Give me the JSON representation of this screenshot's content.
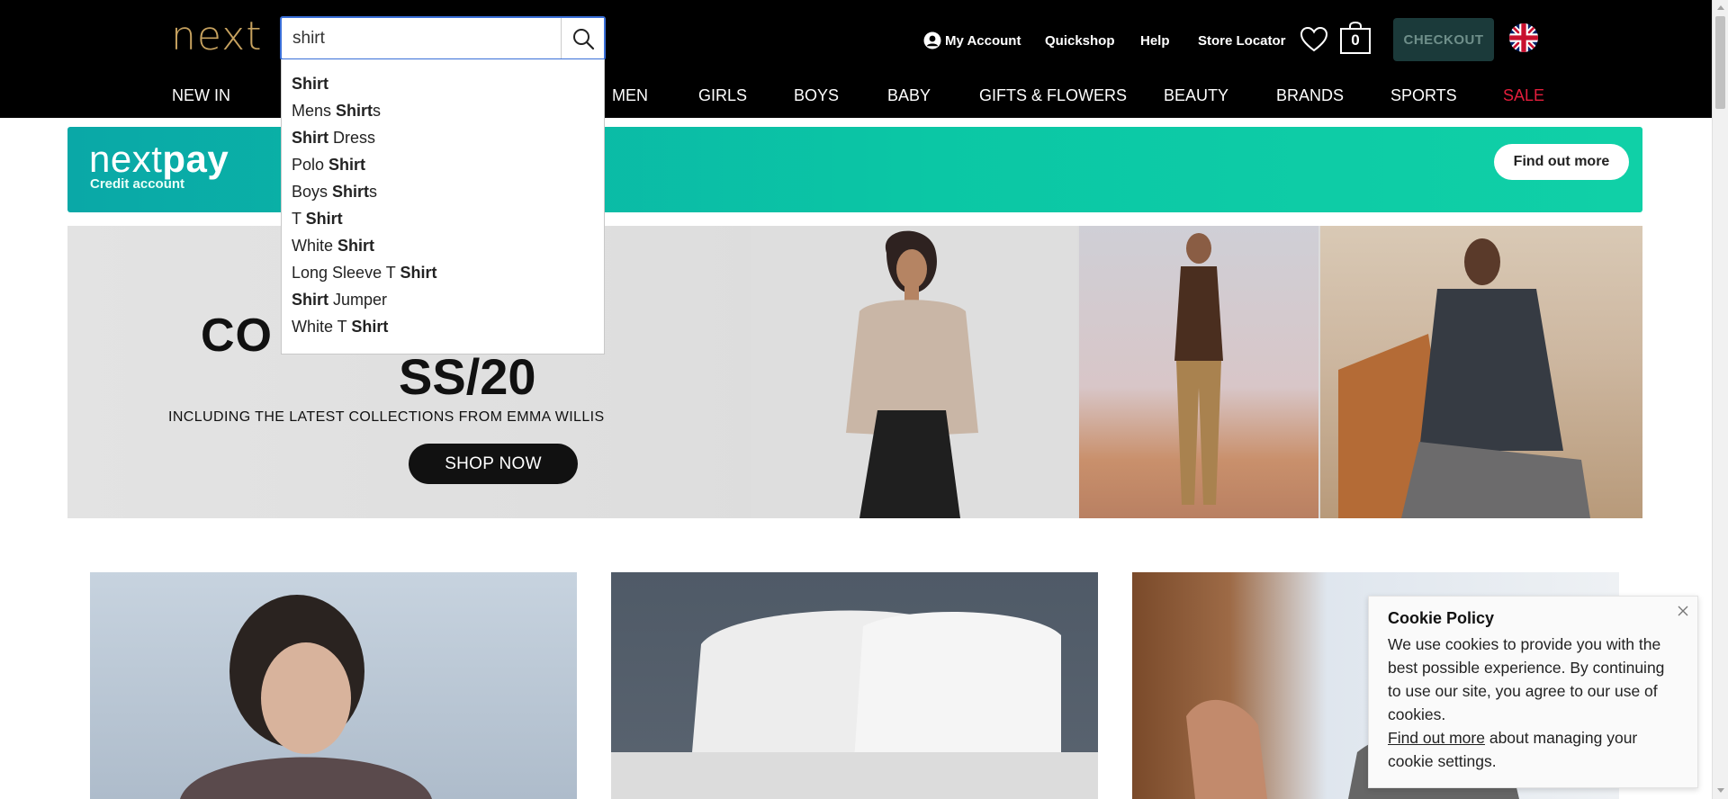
{
  "header": {
    "logo": "next",
    "search": {
      "value": "shirt",
      "button_icon": "search-icon"
    },
    "links": {
      "my_account": "My Account",
      "quickshop": "Quickshop",
      "help": "Help",
      "store_locator": "Store Locator"
    },
    "bag_count": "0",
    "checkout": "CHECKOUT",
    "flag_icon": "uk-flag-icon"
  },
  "nav": {
    "items": [
      "NEW IN",
      "MEN",
      "GIRLS",
      "BOYS",
      "BABY",
      "GIFTS & FLOWERS",
      "BEAUTY",
      "BRANDS",
      "SPORTS",
      "SALE"
    ],
    "sale_color": "#e31e3c"
  },
  "suggestions": [
    {
      "pre": "",
      "bold": "Shirt",
      "post": ""
    },
    {
      "pre": "Mens ",
      "bold": "Shirt",
      "post": "s"
    },
    {
      "pre": "",
      "bold": "Shirt",
      "post": " Dress"
    },
    {
      "pre": "Polo ",
      "bold": "Shirt",
      "post": ""
    },
    {
      "pre": "Boys ",
      "bold": "Shirt",
      "post": "s"
    },
    {
      "pre": "T ",
      "bold": "Shirt",
      "post": ""
    },
    {
      "pre": "White ",
      "bold": "Shirt",
      "post": ""
    },
    {
      "pre": "Long Sleeve T ",
      "bold": "Shirt",
      "post": ""
    },
    {
      "pre": "",
      "bold": "Shirt",
      "post": " Jumper"
    },
    {
      "pre": "White T ",
      "bold": "Shirt",
      "post": ""
    }
  ],
  "nextpay": {
    "logo_next": "next",
    "logo_pay": "pay",
    "subtitle": "Credit account",
    "button": "Find out more",
    "colors": {
      "start": "#0aa8a7",
      "end": "#10d0a7"
    }
  },
  "hero": {
    "title_partial": "CO",
    "season": "SS/20",
    "subtitle": "INCLUDING THE LATEST COLLECTIONS FROM EMMA WILLIS",
    "button": "SHOP NOW"
  },
  "cookie": {
    "title": "Cookie Policy",
    "body": "We use cookies to provide you with the best possible experience. By continuing to use our site, you agree to our use of cookies.",
    "link": "Find out more",
    "link_suffix": " about managing your cookie settings."
  }
}
